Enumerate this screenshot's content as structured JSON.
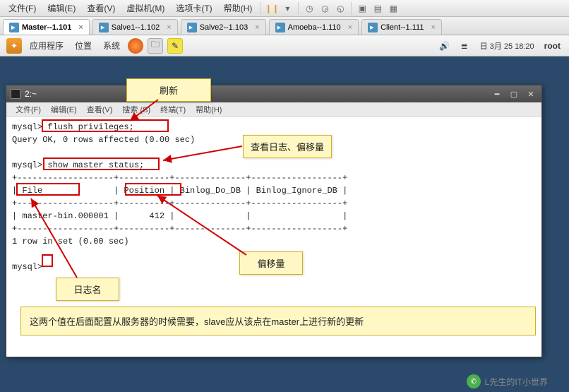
{
  "topmenu": {
    "file": "文件(F)",
    "edit": "编辑(E)",
    "view": "查看(V)",
    "vm": "虚拟机(M)",
    "tabs": "选项卡(T)",
    "help": "帮助(H)"
  },
  "tabs": [
    {
      "label": "Master--1.101",
      "active": true
    },
    {
      "label": "Salve1--1.102",
      "active": false
    },
    {
      "label": "Salve2--1.103",
      "active": false
    },
    {
      "label": "Amoeba--1.110",
      "active": false
    },
    {
      "label": "Client--1.111",
      "active": false
    }
  ],
  "taskbar": {
    "apps": "应用程序",
    "location": "位置",
    "system": "系统",
    "date": "日 3月 25 18:20",
    "user": "root"
  },
  "terminal": {
    "title": "2:~",
    "menus": {
      "file": "文件(F)",
      "edit": "编辑(E)",
      "view": "查看(V)",
      "search": "搜索 (S)",
      "terminal": "终端(T)",
      "help": "帮助(H)"
    },
    "content": "mysql> flush privileges;\nQuery OK, 0 rows affected (0.00 sec)\n\nmysql> show master status;\n+-------------------+----------+--------------+------------------+\n| File              | Position | Binlog_Do_DB | Binlog_Ignore_DB |\n+-------------------+----------+--------------+------------------+\n| master-bin.000001 |      412 |              |                  |\n+-------------------+----------+--------------+------------------+\n1 row in set (0.00 sec)\n\nmysql> "
  },
  "callouts": {
    "refresh": "刷新",
    "view_log": "查看日志、偏移量",
    "log_name": "日志名",
    "offset": "偏移量",
    "footer": "这两个值在后面配置从服务器的时候需要，slave应从该点在master上进行新的更新"
  },
  "watermark": {
    "text": "L先生的IT小世界"
  }
}
